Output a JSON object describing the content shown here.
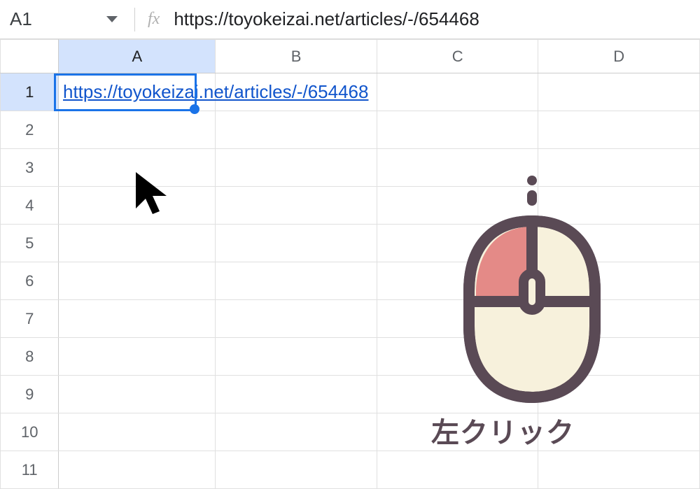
{
  "formula_bar": {
    "cell_ref": "A1",
    "fx_label": "fx",
    "formula_text": "https://toyokeizai.net/articles/-/654468"
  },
  "columns": {
    "A": "A",
    "B": "B",
    "C": "C",
    "D": "D"
  },
  "rows": [
    "1",
    "2",
    "3",
    "4",
    "5",
    "6",
    "7",
    "8",
    "9",
    "10",
    "11"
  ],
  "cells": {
    "A1_link_text": "https://toyokeizai.net/articles/-/654468"
  },
  "annotation": {
    "mouse_label": "左クリック"
  },
  "selected": {
    "col": "A",
    "row": "1"
  }
}
